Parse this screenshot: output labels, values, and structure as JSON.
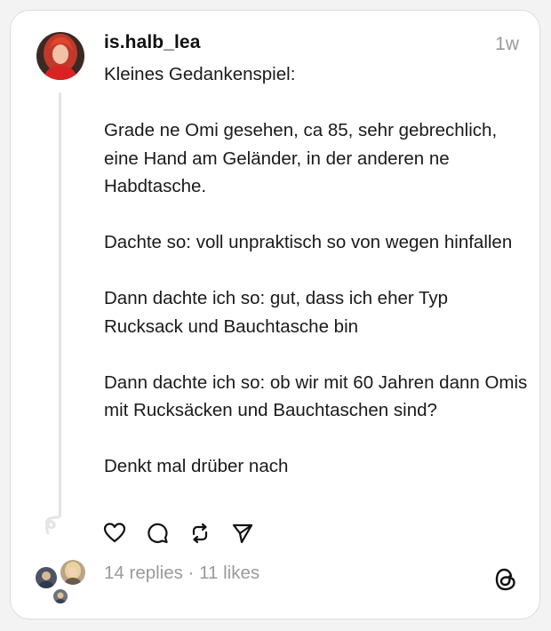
{
  "post": {
    "username": "is.halb_lea",
    "timestamp": "1w",
    "paragraphs": [
      "Kleines Gedankenspiel:",
      "Grade ne Omi gesehen, ca 85, sehr gebrechlich, eine Hand am Geländer, in der anderen ne Habdtasche.",
      "Dachte so: voll unpraktisch so von wegen hinfallen",
      "Dann dachte ich so: gut, dass ich eher Typ Rucksack und Bauchtasche bin",
      "Dann dachte ich so: ob wir mit 60 Jahren dann Omis mit Rucksäcken und Bauchtaschen sind?",
      "Denkt mal drüber nach"
    ],
    "stats": "14 replies · 11 likes"
  },
  "icons": {
    "like": "heart-icon",
    "reply": "comment-icon",
    "repost": "repost-icon",
    "share": "send-icon",
    "brand": "threads-logo-icon"
  },
  "colors": {
    "text": "#1a1a1a",
    "muted": "#9a9a9a",
    "border": "#dcdcdc",
    "background": "#ffffff"
  }
}
